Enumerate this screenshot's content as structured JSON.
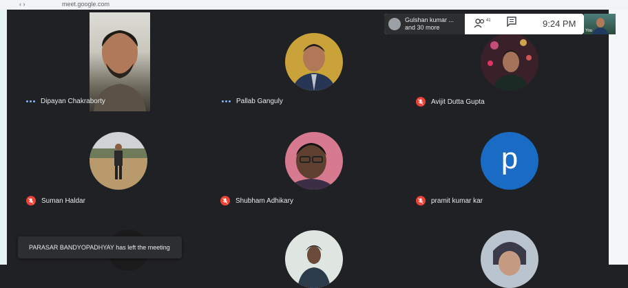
{
  "browser": {
    "url_text": "meet.google.com"
  },
  "participants_chip": {
    "line1": "Gulshan kumar ...",
    "line2": "and 30 more"
  },
  "toolbar": {
    "participant_count": "41",
    "time": "9:24 PM",
    "self_label": "You"
  },
  "tiles": [
    {
      "name": "Dipayan Chakraborty",
      "status": "speaking"
    },
    {
      "name": "Pallab Ganguly",
      "status": "speaking"
    },
    {
      "name": "Avijit Dutta Gupta",
      "status": "muted"
    },
    {
      "name": "Suman Haldar",
      "status": "muted"
    },
    {
      "name": "Shubham Adhikary",
      "status": "muted"
    },
    {
      "name": "pramit kumar kar",
      "status": "muted",
      "initial": "p"
    }
  ],
  "toast": {
    "text": "PARASAR BANDYOPADHYAY has left the meeting"
  },
  "colors": {
    "background": "#202124",
    "mute_red": "#ea4335",
    "accent_blue": "#1a6bc4"
  }
}
